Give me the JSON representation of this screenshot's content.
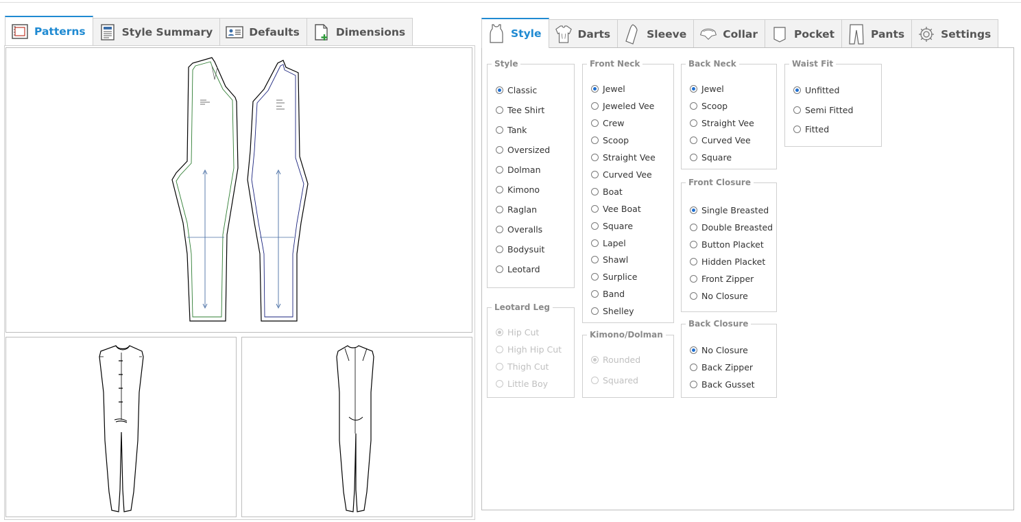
{
  "left_tabs": [
    {
      "label": "Patterns",
      "icon": "patterns-icon",
      "active": true
    },
    {
      "label": "Style Summary",
      "icon": "document-icon",
      "active": false
    },
    {
      "label": "Defaults",
      "icon": "id-card-icon",
      "active": false
    },
    {
      "label": "Dimensions",
      "icon": "add-page-icon",
      "active": false
    }
  ],
  "right_tabs": [
    {
      "label": "Style",
      "icon": "tank-top-icon",
      "active": true
    },
    {
      "label": "Darts",
      "icon": "shirt-icon",
      "active": false
    },
    {
      "label": "Sleeve",
      "icon": "sleeve-icon",
      "active": false
    },
    {
      "label": "Collar",
      "icon": "collar-icon",
      "active": false
    },
    {
      "label": "Pocket",
      "icon": "pocket-icon",
      "active": false
    },
    {
      "label": "Pants",
      "icon": "pants-icon",
      "active": false
    },
    {
      "label": "Settings",
      "icon": "gear-icon",
      "active": false
    }
  ],
  "groups": {
    "style": {
      "legend": "Style",
      "options": [
        "Classic",
        "Tee Shirt",
        "Tank",
        "Oversized",
        "Dolman",
        "Kimono",
        "Raglan",
        "Overalls",
        "Bodysuit",
        "Leotard"
      ],
      "selected": "Classic"
    },
    "leotard_leg": {
      "legend": "Leotard Leg",
      "options": [
        "Hip Cut",
        "High Hip Cut",
        "Thigh Cut",
        "Little Boy"
      ],
      "selected": "Hip Cut",
      "disabled": true
    },
    "front_neck": {
      "legend": "Front Neck",
      "options": [
        "Jewel",
        "Jeweled Vee",
        "Crew",
        "Scoop",
        "Straight Vee",
        "Curved Vee",
        "Boat",
        "Vee Boat",
        "Square",
        "Lapel",
        "Shawl",
        "Surplice",
        "Band",
        "Shelley"
      ],
      "selected": "Jewel"
    },
    "kimono_dolman": {
      "legend": "Kimono/Dolman",
      "options": [
        "Rounded",
        "Squared"
      ],
      "selected": "Rounded",
      "disabled": true
    },
    "back_neck": {
      "legend": "Back Neck",
      "options": [
        "Jewel",
        "Scoop",
        "Straight Vee",
        "Curved Vee",
        "Square"
      ],
      "selected": "Jewel"
    },
    "front_closure": {
      "legend": "Front Closure",
      "options": [
        "Single Breasted",
        "Double Breasted",
        "Button Placket",
        "Hidden Placket",
        "Front Zipper",
        "No Closure"
      ],
      "selected": "Single Breasted"
    },
    "back_closure": {
      "legend": "Back Closure",
      "options": [
        "No Closure",
        "Back Zipper",
        "Back Gusset"
      ],
      "selected": "No Closure"
    },
    "waist_fit": {
      "legend": "Waist Fit",
      "options": [
        "Unfitted",
        "Semi Fitted",
        "Fitted"
      ],
      "selected": "Unfitted"
    }
  },
  "colors": {
    "accent": "#1f8ad2",
    "front_seam": "#2e7d32",
    "back_seam": "#1a237e",
    "grainline": "#4a6fa5"
  }
}
